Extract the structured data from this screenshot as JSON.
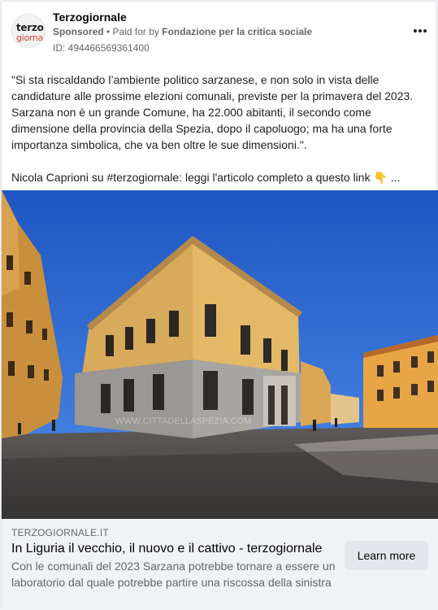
{
  "post": {
    "page_name": "Terzogiornale",
    "sponsored": "Sponsored",
    "paid_for_prefix": "• Paid for by",
    "payer": "Fondazione per la critica sociale",
    "ad_id": "ID: 494466569361400",
    "avatar_text_top": "terzo",
    "avatar_text_bottom": "giornale",
    "body": {
      "paragraph_1": "\"Si sta riscaldando l’ambiente politico sarzanese, e non solo in vista delle candidature alle prossime elezioni comunali, previste per la primavera del 2023. Sarzana non è un grande Comune, ha 22.000 abitanti, il secondo come dimensione della provincia della Spezia, dopo il capoluogo; ma ha una forte importanza simbolica, che va ben oltre le sue dimensioni.\".",
      "paragraph_2": "Nicola Caprioni su #terzogiornale: leggi l'articolo completo a questo link 👇 ..."
    },
    "image_watermark": "WWW.CITTADELLASPEZIA.COM"
  },
  "link_preview": {
    "domain": "TERZOGIORNALE.IT",
    "headline": "In Liguria il vecchio, il nuovo e il cattivo - terzogiornale",
    "description": "Con le comunali del 2023 Sarzana potrebbe tornare a essere un laboratorio dal quale potrebbe partire una riscossa della sinistra",
    "cta_label": "Learn more"
  },
  "icons": {
    "more": "more-options-icon"
  },
  "colors": {
    "sky": "#2f6fd6",
    "facade": "#e0b766",
    "stone": "#9a9794"
  }
}
